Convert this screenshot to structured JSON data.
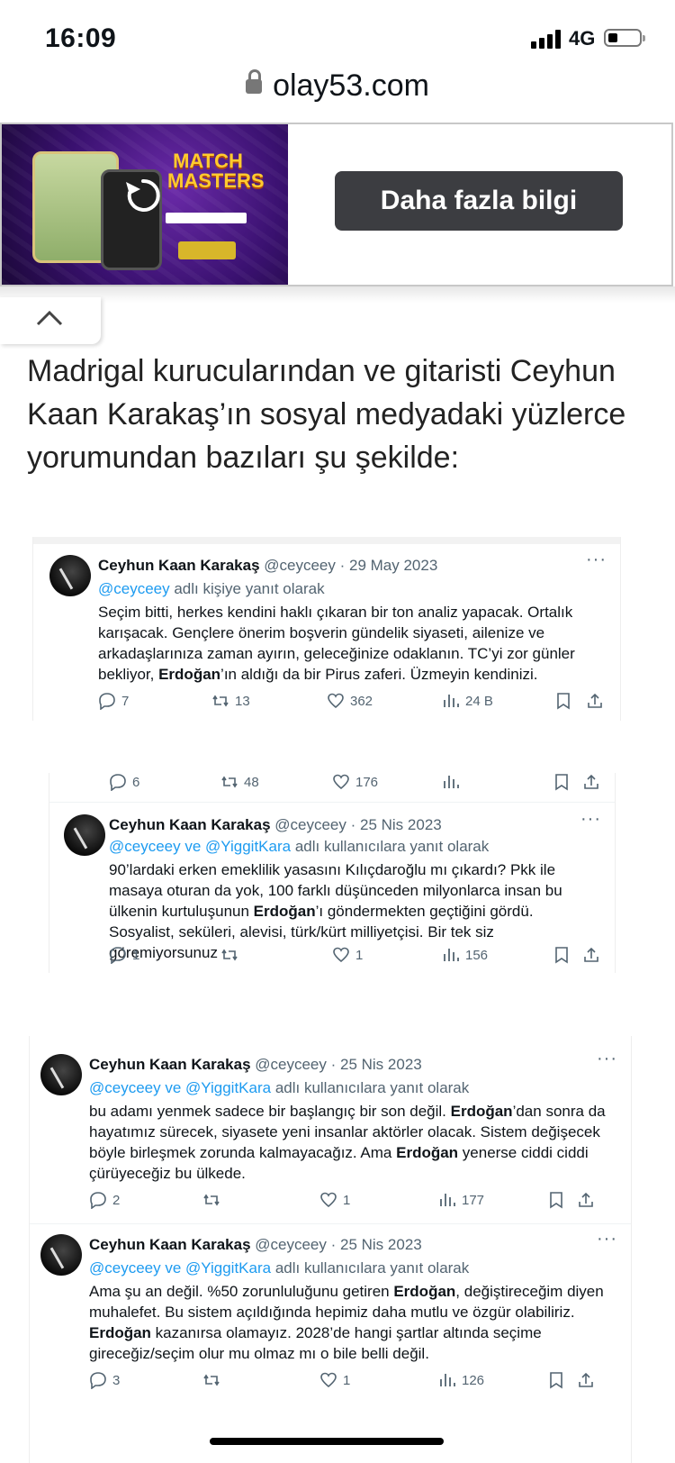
{
  "status": {
    "time": "16:09",
    "network": "4G"
  },
  "browser": {
    "url": "olay53.com"
  },
  "ad": {
    "logo": "MATCH MASTERS",
    "cta": "Daha fazla bilgi"
  },
  "article": {
    "text": "Madrigal kurucularından ve gitaristi Ceyhun Kaan Karakaş’ın sosyal medyadaki yüzlerce yorumundan bazıları şu şekilde:"
  },
  "tweets": [
    {
      "name": "Ceyhun Kaan Karakaş",
      "meta": "@ceyceey · 29 May 2023",
      "reply_handles": "@ceyceey",
      "reply_suffix": " adlı kişiye yanıt olarak",
      "text_html": "Seçim bitti, herkes kendini haklı çıkaran bir ton analiz yapacak. Ortalık karışacak. Gençlere önerim boşverin gündelik siyaseti, ailenize ve arkadaşlarınıza zaman ayırın, geleceğinize odaklanın. TC’yi zor günler bekliyor, <b>Erdoğan</b>’ın aldığı da bir Pirus zaferi. Üzmeyin kendinizi.",
      "replies": "7",
      "retweets": "13",
      "likes": "362",
      "views": "24 B"
    },
    {
      "prev_stats": {
        "replies": "6",
        "retweets": "48",
        "likes": "176",
        "views": ""
      },
      "name": "Ceyhun Kaan Karakaş",
      "meta": "@ceyceey · 25 Nis 2023",
      "reply_handles": "@ceyceey ve @YiggitKara",
      "reply_suffix": " adlı kullanıcılara yanıt olarak",
      "text_html": "90’lardaki erken emeklilik yasasını Kılıçdaroğlu mı çıkardı? Pkk ile masaya oturan da yok, 100 farklı düşünceden milyonlarca insan bu ülkenin kurtuluşunun <b>Erdoğan</b>’ı göndermekten geçtiğini gördü. Sosyalist, seküleri, alevisi, türk/kürt milliyetçisi. Bir tek siz göremiyorsunuz",
      "replies": "1",
      "retweets": "",
      "likes": "1",
      "views": "156"
    },
    {
      "name": "Ceyhun Kaan Karakaş",
      "meta": "@ceyceey · 25 Nis 2023",
      "reply_handles": "@ceyceey ve @YiggitKara",
      "reply_suffix": " adlı kullanıcılara yanıt olarak",
      "text_html": "bu adamı yenmek sadece bir başlangıç bir son değil. <b>Erdoğan</b>’dan sonra da hayatımız sürecek, siyasete yeni insanlar aktörler olacak. Sistem değişecek böyle birleşmek zorunda kalmayacağız. Ama <b>Erdoğan</b> yenerse ciddi ciddi çürüyeceğiz bu ülkede.",
      "replies": "2",
      "retweets": "",
      "likes": "1",
      "views": "177"
    },
    {
      "name": "Ceyhun Kaan Karakaş",
      "meta": "@ceyceey · 25 Nis 2023",
      "reply_handles": "@ceyceey ve @YiggitKara",
      "reply_suffix": " adlı kullanıcılara yanıt olarak",
      "text_html": "Ama şu an değil. %50 zorunluluğunu getiren <b>Erdoğan</b>, değiştireceğim diyen muhalefet. Bu sistem açıldığında hepimiz daha mutlu ve özgür olabiliriz. <b>Erdoğan</b> kazanırsa olamayız. 2028’de hangi şartlar altında seçime gireceğiz/seçim olur mu olmaz mı o bile belli değil.",
      "replies": "3",
      "retweets": "",
      "likes": "1",
      "views": "126"
    }
  ]
}
